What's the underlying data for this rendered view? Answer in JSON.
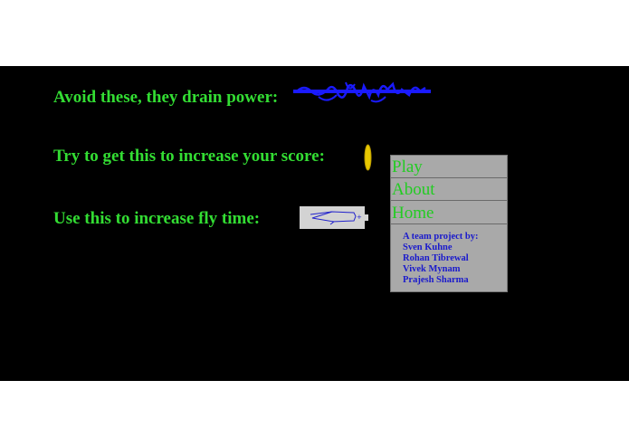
{
  "instructions": {
    "avoid": "Avoid these, they drain power:",
    "score": "Try to get this to increase your score:",
    "fly": "Use this to increase fly time:"
  },
  "sprites": {
    "obstacle": "scribble-obstacle-icon",
    "coin": "gold-coin-icon",
    "battery": "battery-icon"
  },
  "menu": {
    "play": "Play",
    "about": "About",
    "home": "Home"
  },
  "credits": {
    "heading": "A team project by:",
    "members": [
      "Sven Kuhne",
      "Rohan Tibrewal",
      "Vivek Mynam",
      "Prajesh Sharma"
    ]
  },
  "colors": {
    "background": "#000000",
    "instruction_text": "#33dd33",
    "menu_bg": "#a9a9a9",
    "menu_text": "#22cc22",
    "credits_text": "#1a1acc",
    "obstacle": "#1a1aff",
    "coin": "#e8c800"
  }
}
